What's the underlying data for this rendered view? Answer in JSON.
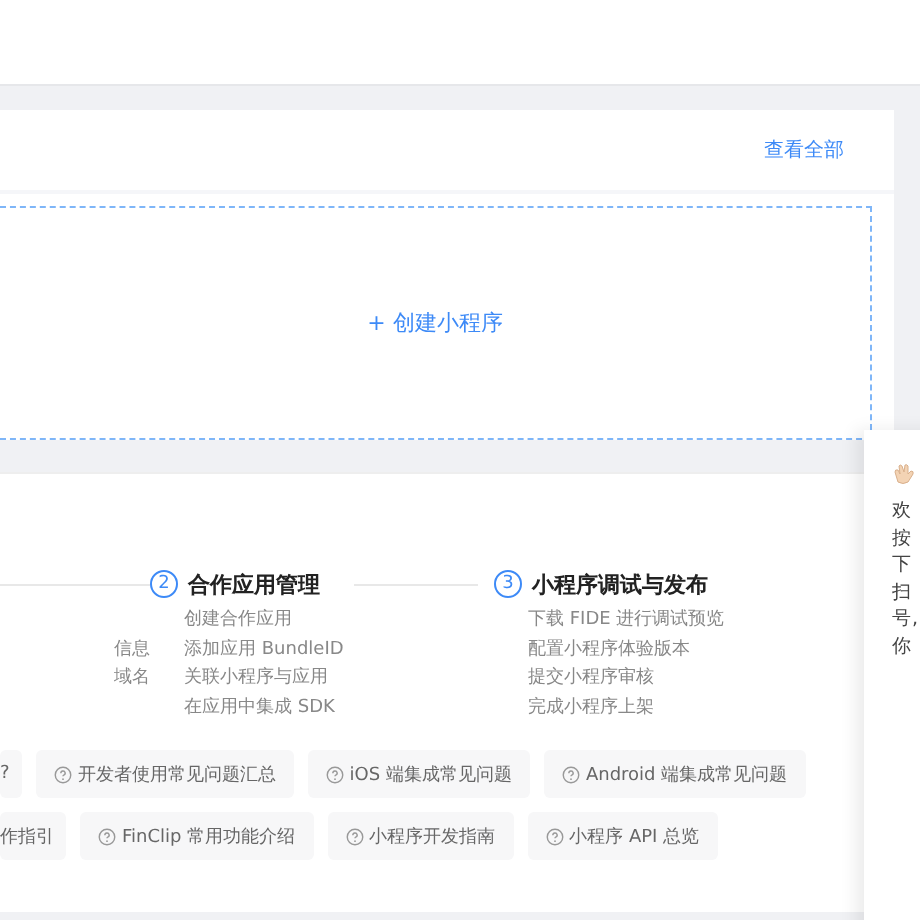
{
  "apps_card": {
    "view_all": "查看全部",
    "create_button": "+ 创建小程序"
  },
  "steps": [
    {
      "items": [
        "信息",
        "域名"
      ]
    },
    {
      "number": "2",
      "title": "合作应用管理",
      "items": [
        "创建合作应用",
        "添加应用 BundleID",
        "关联小程序与应用",
        "在应用中集成 SDK"
      ]
    },
    {
      "number": "3",
      "title": "小程序调试与发布",
      "items": [
        "下载 FIDE 进行调试预览",
        "配置小程序体验版本",
        "提交小程序审核",
        "完成小程序上架"
      ]
    }
  ],
  "faq_rows": [
    [
      "?",
      "开发者使用常见问题汇总",
      "iOS 端集成常见问题",
      "Android 端集成常见问题"
    ],
    [
      "作指引",
      "FinClip 常用功能介绍",
      "小程序开发指南",
      "小程序 API 总览"
    ]
  ],
  "side_panel": {
    "lines": [
      "欢",
      "按",
      "下",
      "扫",
      "号,",
      "你"
    ]
  }
}
